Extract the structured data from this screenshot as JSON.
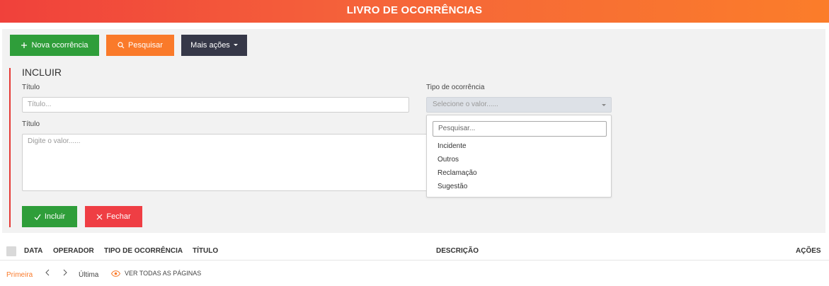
{
  "header": {
    "title": "LIVRO DE OCORRÊNCIAS"
  },
  "toolbar": {
    "new_label": "Nova ocorrência",
    "search_label": "Pesquisar",
    "more_label": "Mais ações"
  },
  "form": {
    "section_title": "INCLUIR",
    "title_label": "Título",
    "title_placeholder": "Título...",
    "type_label": "Tipo de ocorrência",
    "type_placeholder": "Selecione o valor......",
    "desc_label": "Título",
    "desc_placeholder": "Digite o valor......",
    "dropdown": {
      "search_placeholder": "Pesquisar...",
      "options": [
        "Incidente",
        "Outros",
        "Reclamação",
        "Sugestão"
      ]
    },
    "include_label": "Incluir",
    "close_label": "Fechar"
  },
  "table": {
    "columns": [
      "DATA",
      "OPERADOR",
      "TIPO DE OCORRÊNCIA",
      "TÍTULO",
      "DESCRIÇÃO",
      "AÇÕES"
    ]
  },
  "pager": {
    "first": "Primeira",
    "last": "Última",
    "view_all": "VER TODAS AS PÁGINAS"
  },
  "colors": {
    "header_start": "#f0413b",
    "header_end": "#fb7d2a",
    "green": "#2f9e3a",
    "orange": "#fa7a2a",
    "dark": "#363848",
    "red": "#ef3e44"
  }
}
